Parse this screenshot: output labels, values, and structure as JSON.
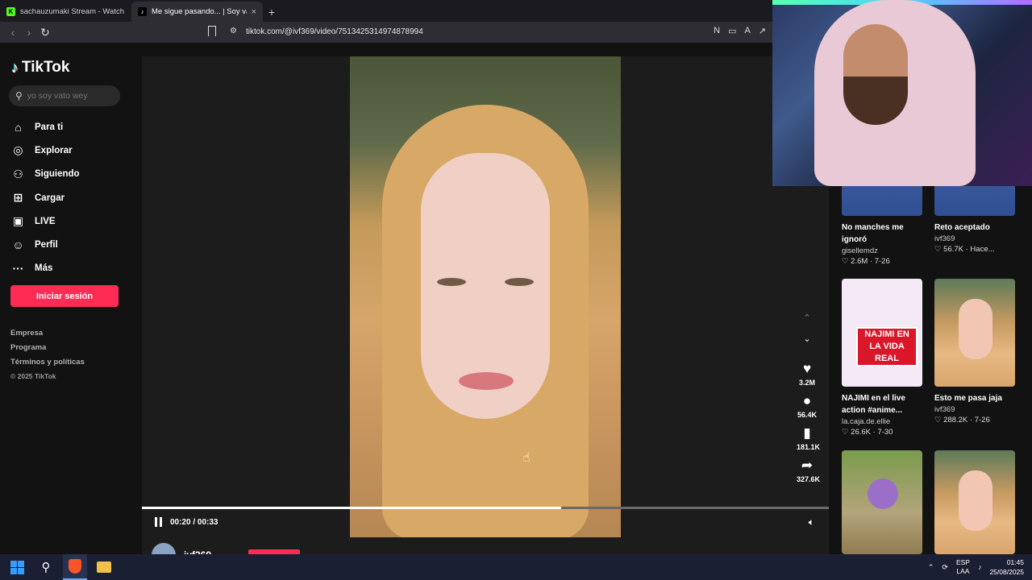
{
  "browser": {
    "tabs": [
      {
        "title": "sachauzumaki Stream - Watch Live o",
        "favicon": "kick-logo"
      },
      {
        "title": "Me sigue pasando... | Soy vat",
        "favicon": "tiktok-logo",
        "close": "×"
      }
    ],
    "new_tab": "+",
    "url": "tiktok.com/@ivf369/video/7513425314974878994"
  },
  "tiktok": {
    "logo": "TikTok",
    "search_placeholder": "yo soy vato wey",
    "nav": [
      {
        "label": "Para ti",
        "icon": "home-icon"
      },
      {
        "label": "Explorar",
        "icon": "compass-icon"
      },
      {
        "label": "Siguiendo",
        "icon": "following-icon"
      },
      {
        "label": "Cargar",
        "icon": "upload-icon"
      },
      {
        "label": "LIVE",
        "icon": "live-icon"
      },
      {
        "label": "Perfil",
        "icon": "profile-icon"
      },
      {
        "label": "Más",
        "icon": "more-icon"
      }
    ],
    "login_label": "Iniciar sesión",
    "footer": [
      "Empresa",
      "Programa",
      "Términos y políticas",
      "© 2025 TikTok"
    ]
  },
  "player": {
    "time": "00:20 / 00:33",
    "progress": 0.61,
    "author": "ivf369",
    "counts": {
      "likes": "3.2M",
      "comments": "56.4K",
      "saves": "181.1K",
      "shares": "327.6K"
    }
  },
  "related": [
    {
      "title": "No manches me ignoró",
      "user": "gisellemdz",
      "meta": "♡ 2.6M · 7-26",
      "thumb": "blue"
    },
    {
      "title": "Reto aceptado",
      "user": "ivf369",
      "meta": "♡ 56.7K · Hace...",
      "thumb": "blue"
    },
    {
      "title": "NAJIMI en el live action #anime...",
      "user": "la.caja.de.ellie",
      "meta": "♡ 26.6K · 7-30",
      "thumb": "anime",
      "thumb_text": "NAJIMI EN LA VIDA REAL"
    },
    {
      "title": "Esto me pasa jaja",
      "user": "ivf369",
      "meta": "♡ 288.2K · 7-26",
      "thumb": "blonde"
    }
  ],
  "taskbar": {
    "lang": [
      "ESP",
      "LAA"
    ],
    "time": "01:45",
    "date": "25/08/2025"
  },
  "colors": {
    "accent": "#fe2c55",
    "background": "#121212"
  }
}
